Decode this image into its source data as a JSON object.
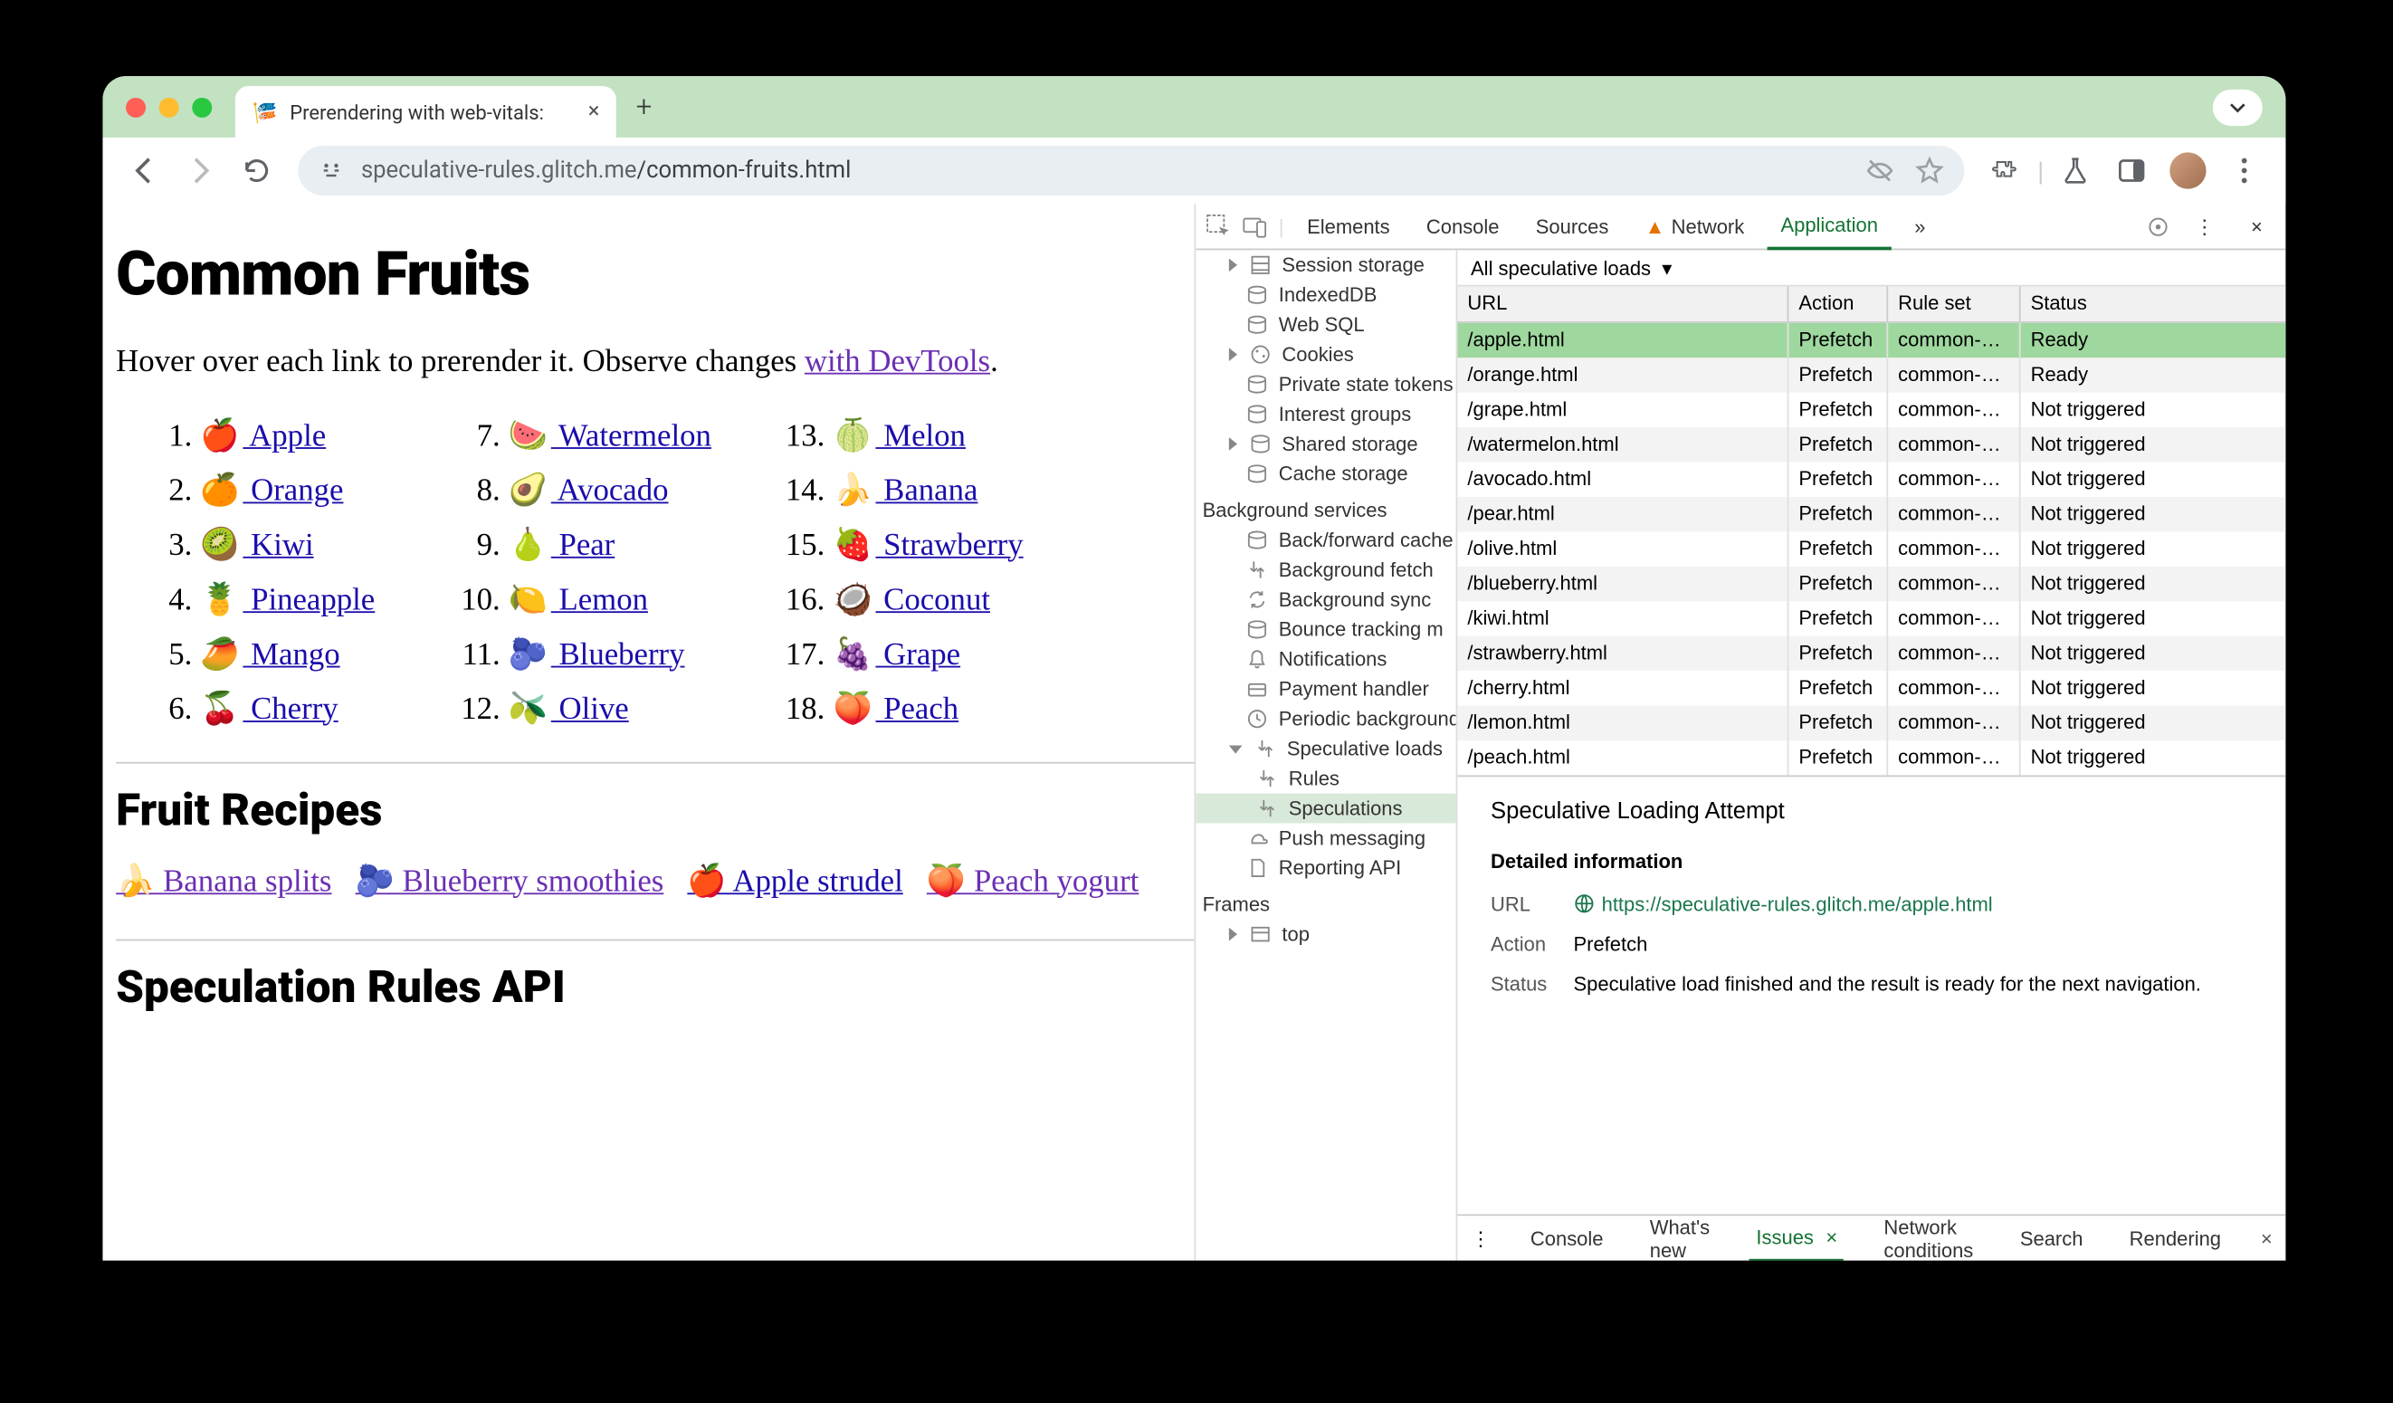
{
  "browser": {
    "tab_title": "Prerendering with web-vitals:",
    "url_host": "speculative-rules.glitch.me",
    "url_path": "/common-fruits.html"
  },
  "page": {
    "h1": "Common Fruits",
    "intro_before": "Hover over each link to prerender it. Observe changes ",
    "intro_link": "with DevTools",
    "intro_after": ".",
    "fruits": [
      {
        "n": "1.",
        "e": "🍎",
        "t": "Apple"
      },
      {
        "n": "7.",
        "e": "🍉",
        "t": "Watermelon"
      },
      {
        "n": "13.",
        "e": "🍈",
        "t": "Melon"
      },
      {
        "n": "2.",
        "e": "🍊",
        "t": "Orange"
      },
      {
        "n": "8.",
        "e": "🥑",
        "t": "Avocado"
      },
      {
        "n": "14.",
        "e": "🍌",
        "t": "Banana"
      },
      {
        "n": "3.",
        "e": "🥝",
        "t": "Kiwi"
      },
      {
        "n": "9.",
        "e": "🍐",
        "t": "Pear"
      },
      {
        "n": "15.",
        "e": "🍓",
        "t": "Strawberry"
      },
      {
        "n": "4.",
        "e": "🍍",
        "t": "Pineapple"
      },
      {
        "n": "10.",
        "e": "🍋",
        "t": "Lemon"
      },
      {
        "n": "16.",
        "e": "🥥",
        "t": "Coconut"
      },
      {
        "n": "5.",
        "e": "🥭",
        "t": "Mango"
      },
      {
        "n": "11.",
        "e": "🫐",
        "t": "Blueberry"
      },
      {
        "n": "17.",
        "e": "🍇",
        "t": "Grape"
      },
      {
        "n": "6.",
        "e": "🍒",
        "t": "Cherry"
      },
      {
        "n": "12.",
        "e": "🫒",
        "t": "Olive"
      },
      {
        "n": "18.",
        "e": "🍑",
        "t": "Peach"
      }
    ],
    "h2_recipes": "Fruit Recipes",
    "recipes": [
      {
        "e": "🍌",
        "t": "Banana splits",
        "v": true
      },
      {
        "e": "🫐",
        "t": "Blueberry smoothies",
        "v": true
      },
      {
        "e": "🍎",
        "t": "Apple strudel",
        "v": false
      },
      {
        "e": "🍑",
        "t": "Peach yogurt",
        "v": true
      }
    ],
    "h2_api": "Speculation Rules API"
  },
  "devtools": {
    "tabs": {
      "elements": "Elements",
      "console": "Console",
      "sources": "Sources",
      "network": "Network",
      "application": "Application"
    },
    "sidebar": {
      "session": "Session storage",
      "indexed": "IndexedDB",
      "websql": "Web SQL",
      "cookies": "Cookies",
      "priv": "Private state tokens",
      "interest": "Interest groups",
      "shared": "Shared storage",
      "cache": "Cache storage",
      "bg_section": "Background services",
      "bfcache": "Back/forward cache",
      "bgfetch": "Background fetch",
      "bgsync": "Background sync",
      "bounce": "Bounce tracking m",
      "notif": "Notifications",
      "payment": "Payment handler",
      "periodic": "Periodic background",
      "spec": "Speculative loads",
      "rules": "Rules",
      "speculations": "Speculations",
      "push": "Push messaging",
      "reporting": "Reporting API",
      "frames_section": "Frames",
      "top": "top"
    },
    "filter": "All speculative loads",
    "columns": {
      "url": "URL",
      "action": "Action",
      "ruleset": "Rule set",
      "status": "Status"
    },
    "rows": [
      {
        "url": "/apple.html",
        "action": "Prefetch",
        "rule": "common-…",
        "status": "Ready",
        "sel": true
      },
      {
        "url": "/orange.html",
        "action": "Prefetch",
        "rule": "common-…",
        "status": "Ready"
      },
      {
        "url": "/grape.html",
        "action": "Prefetch",
        "rule": "common-…",
        "status": "Not triggered"
      },
      {
        "url": "/watermelon.html",
        "action": "Prefetch",
        "rule": "common-…",
        "status": "Not triggered"
      },
      {
        "url": "/avocado.html",
        "action": "Prefetch",
        "rule": "common-…",
        "status": "Not triggered"
      },
      {
        "url": "/pear.html",
        "action": "Prefetch",
        "rule": "common-…",
        "status": "Not triggered"
      },
      {
        "url": "/olive.html",
        "action": "Prefetch",
        "rule": "common-…",
        "status": "Not triggered"
      },
      {
        "url": "/blueberry.html",
        "action": "Prefetch",
        "rule": "common-…",
        "status": "Not triggered"
      },
      {
        "url": "/kiwi.html",
        "action": "Prefetch",
        "rule": "common-…",
        "status": "Not triggered"
      },
      {
        "url": "/strawberry.html",
        "action": "Prefetch",
        "rule": "common-…",
        "status": "Not triggered"
      },
      {
        "url": "/cherry.html",
        "action": "Prefetch",
        "rule": "common-…",
        "status": "Not triggered"
      },
      {
        "url": "/lemon.html",
        "action": "Prefetch",
        "rule": "common-…",
        "status": "Not triggered"
      },
      {
        "url": "/peach.html",
        "action": "Prefetch",
        "rule": "common-…",
        "status": "Not triggered"
      }
    ],
    "detail": {
      "title": "Speculative Loading Attempt",
      "info": "Detailed information",
      "url_k": "URL",
      "url_v": "https://speculative-rules.glitch.me/apple.html",
      "action_k": "Action",
      "action_v": "Prefetch",
      "status_k": "Status",
      "status_v": "Speculative load finished and the result is ready for the next navigation."
    },
    "drawer": {
      "console": "Console",
      "whatsnew": "What's new",
      "issues": "Issues",
      "netcond": "Network conditions",
      "search": "Search",
      "rendering": "Rendering"
    }
  }
}
